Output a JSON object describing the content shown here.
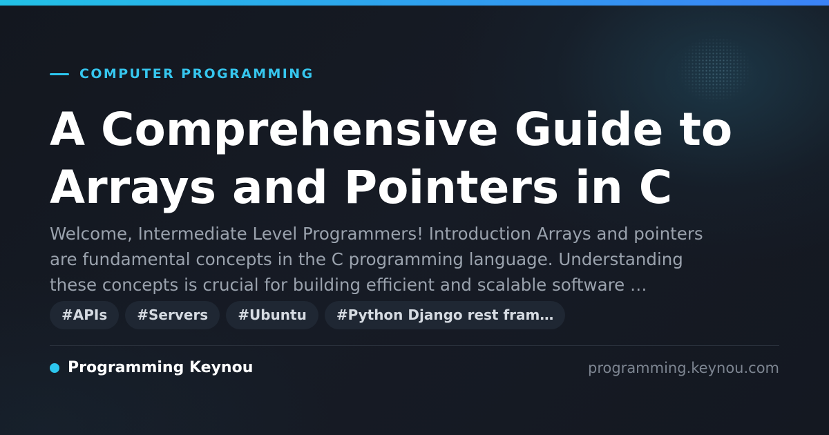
{
  "category": "COMPUTER PROGRAMMING",
  "title_lines": [
    "A Comprehensive Guide to",
    "Arrays and Pointers in C"
  ],
  "excerpt_lines": [
    "Welcome, Intermediate Level Programmers! Introduction Arrays and pointers",
    "are fundamental concepts in the C programming language. Understanding",
    "these concepts is crucial for building efficient and scalable software …"
  ],
  "tags": [
    "#APIs",
    "#Servers",
    "#Ubuntu",
    "#Python Django rest fram…"
  ],
  "brand": {
    "name": "Programming Keynou",
    "domain": "programming.keynou.com"
  },
  "colors": {
    "accent": "#2cc6ee",
    "accent_gradient_end": "#3b82f6",
    "background": "#141821",
    "title": "#ffffff",
    "excerpt": "#9aa2ad",
    "tag_background": "#1f2733",
    "domain_text": "#7d8591"
  }
}
